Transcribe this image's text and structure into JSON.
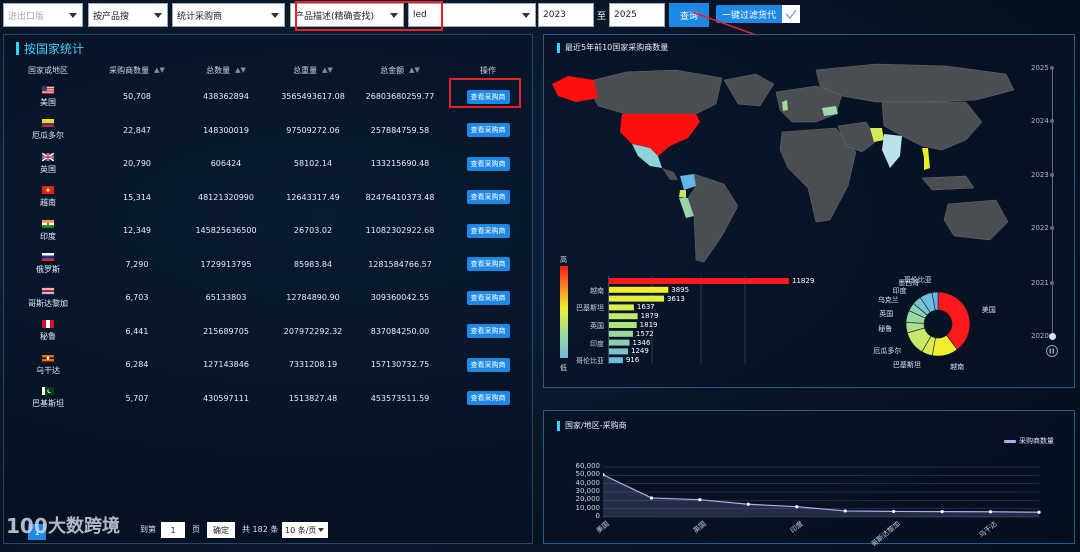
{
  "filters": {
    "import_export": {
      "placeholder": "进出口版"
    },
    "search_by": {
      "value": "按产品搜"
    },
    "stat_type": {
      "value": "统计采购商"
    },
    "field": {
      "value": "产品描述(精确查找)"
    },
    "keyword": {
      "value": "led"
    },
    "year_from": {
      "value": "2023"
    },
    "year_sep": "至",
    "year_to": {
      "value": "2025"
    },
    "query_label": "查询",
    "filter_label": "一键过滤货代",
    "filter_checked": true
  },
  "left_panel": {
    "title": "按国家统计",
    "headers": {
      "country": "国家或地区",
      "buyers": "采购商数量",
      "qty": "总数量",
      "weight": "总重量",
      "amount": "总金额",
      "action": "操作"
    },
    "view_label": "查看采购商",
    "rows": [
      {
        "country": "美国",
        "flag": "us",
        "buyers": "50,708",
        "qty": "438362894",
        "weight": "3565493617.08",
        "amount": "26803680259.77"
      },
      {
        "country": "厄瓜多尔",
        "flag": "ec",
        "buyers": "22,847",
        "qty": "148300019",
        "weight": "97509272.06",
        "amount": "257884759.58"
      },
      {
        "country": "英国",
        "flag": "gb",
        "buyers": "20,790",
        "qty": "606424",
        "weight": "58102.14",
        "amount": "133215690.48"
      },
      {
        "country": "越南",
        "flag": "vn",
        "buyers": "15,314",
        "qty": "48121320990",
        "weight": "12643317.49",
        "amount": "82476410373.48"
      },
      {
        "country": "印度",
        "flag": "in",
        "buyers": "12,349",
        "qty": "145825636500",
        "weight": "26703.02",
        "amount": "11082302922.68"
      },
      {
        "country": "俄罗斯",
        "flag": "ru",
        "buyers": "7,290",
        "qty": "1729913795",
        "weight": "85983.84",
        "amount": "1281584766.57"
      },
      {
        "country": "哥斯达黎加",
        "flag": "cr",
        "buyers": "6,703",
        "qty": "65133803",
        "weight": "12784890.90",
        "amount": "309360042.55"
      },
      {
        "country": "秘鲁",
        "flag": "pe",
        "buyers": "6,441",
        "qty": "215689705",
        "weight": "207972292.32",
        "amount": "837084250.00"
      },
      {
        "country": "乌干达",
        "flag": "ug",
        "buyers": "6,284",
        "qty": "127143846",
        "weight": "7331208.19",
        "amount": "157130732.75"
      },
      {
        "country": "巴基斯坦",
        "flag": "pk",
        "buyers": "5,707",
        "qty": "430597111",
        "weight": "1513827.48",
        "amount": "453573511.59"
      }
    ],
    "pager": {
      "page": "1",
      "goto_prefix": "到第",
      "goto_value": "1",
      "goto_suffix": "页",
      "confirm": "确定",
      "total": "共 182 条",
      "page_size": "10 条/页"
    }
  },
  "watermark": "大数跨境",
  "map_panel": {
    "title": "最近5年前10国家采购商数量",
    "timeline": [
      "2025",
      "2024",
      "2023",
      "2022",
      "2021",
      "2020"
    ],
    "legend_high": "高",
    "legend_low": "低"
  },
  "line_panel": {
    "title": "国家/地区-采购商",
    "legend": "采购商数量"
  },
  "chart_data": [
    {
      "type": "bar",
      "orientation": "horizontal",
      "categories": [
        "",
        "越南",
        "",
        "巴基斯坦",
        "",
        "英国",
        "",
        "印度",
        "",
        "哥伦比亚"
      ],
      "values": [
        11829,
        3895,
        3613,
        1637,
        1879,
        1819,
        1572,
        1346,
        1249,
        916
      ],
      "value_labels": [
        "11829",
        "3895",
        "3613",
        "1637",
        "1879",
        "1819",
        "1572",
        "1346",
        "1249",
        "916"
      ]
    },
    {
      "type": "pie",
      "style": "donut",
      "labels": [
        "美国",
        "越南",
        "巴基斯坦",
        "厄瓜多尔",
        "秘鲁",
        "英国",
        "乌克兰",
        "印度",
        "墨西哥",
        "哥伦比亚"
      ],
      "values": [
        11829,
        3895,
        1637,
        3613,
        1572,
        1819,
        1249,
        1346,
        1879,
        916
      ],
      "colors": [
        "#ff1a1a",
        "#f2ee2e",
        "#d9ec52",
        "#c5e86a",
        "#acdf86",
        "#9bd8a0",
        "#8ccfb4",
        "#7ec4c8",
        "#70bade",
        "#66b0ee"
      ]
    },
    {
      "type": "line",
      "series": [
        {
          "name": "采购商数量",
          "values": [
            50708,
            22847,
            20790,
            15314,
            12349,
            7290,
            6703,
            6441,
            6284,
            5707
          ]
        }
      ],
      "categories": [
        "美国",
        "厄瓜多尔",
        "英国",
        "越南",
        "印度",
        "俄罗斯",
        "哥斯达黎加",
        "秘鲁",
        "乌干达",
        "巴基斯坦"
      ],
      "x_tick_labels": [
        "美国",
        "英国",
        "印度",
        "哥斯达黎加",
        "乌干达"
      ],
      "y_ticks": [
        "60,000",
        "50,000",
        "40,000",
        "30,000",
        "20,000",
        "10,000",
        "0"
      ],
      "ylim": [
        0,
        60000
      ],
      "grid": true,
      "legend_position": "top-right"
    }
  ]
}
